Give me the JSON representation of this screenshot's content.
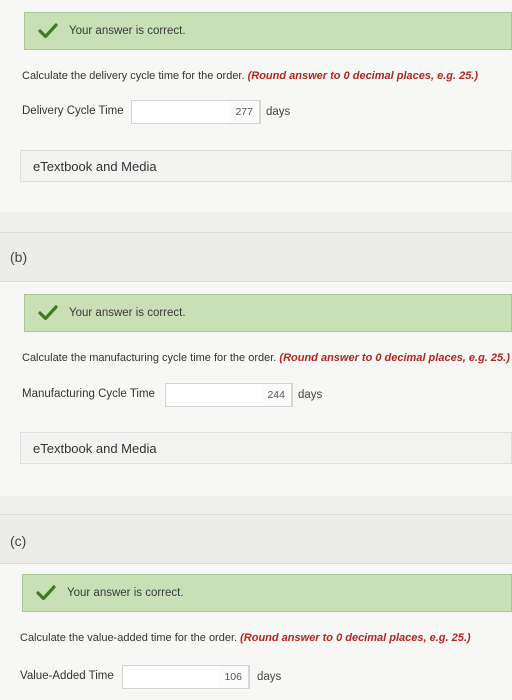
{
  "parts": [
    {
      "label": "",
      "correct_message": "Your answer is correct.",
      "question": "Calculate the delivery cycle time for the order.",
      "hint": "(Round answer to 0 decimal places, e.g. 25.)",
      "field_label": "Delivery Cycle Time",
      "answer_value": "277",
      "unit": "days",
      "etext_label": "eTextbook and Media"
    },
    {
      "label": "(b)",
      "correct_message": "Your answer is correct.",
      "question": "Calculate the manufacturing cycle time for the order.",
      "hint": "(Round answer to 0 decimal places, e.g. 25.)",
      "field_label": "Manufacturing Cycle Time",
      "answer_value": "244",
      "unit": "days",
      "etext_label": "eTextbook and Media"
    },
    {
      "label": "(c)",
      "correct_message": "Your answer is correct.",
      "question": "Calculate the value-added time for the order.",
      "hint": "(Round answer to 0 decimal places, e.g. 25.)",
      "field_label": "Value-Added Time",
      "answer_value": "106",
      "unit": "days"
    }
  ],
  "colors": {
    "correct_bg": "#c9dfb6",
    "check_green": "#3e7d1f",
    "hint_red": "#b3261e"
  }
}
